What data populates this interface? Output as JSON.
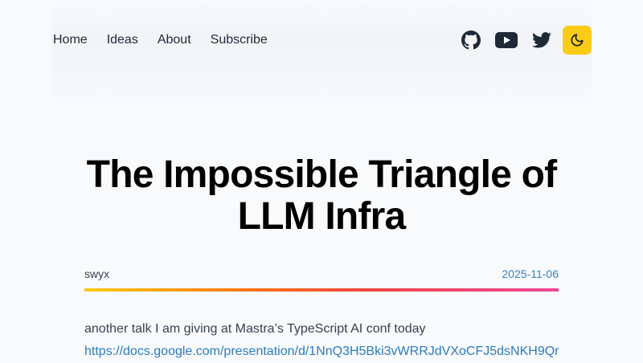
{
  "nav": {
    "items": [
      {
        "label": "Home"
      },
      {
        "label": "Ideas"
      },
      {
        "label": "About"
      },
      {
        "label": "Subscribe"
      }
    ],
    "social_icons": [
      "github-icon",
      "youtube-icon",
      "twitter-icon"
    ],
    "theme_toggle_icon": "moon-icon",
    "accent_color": "#facc15"
  },
  "post": {
    "title": "The Impossible Triangle of LLM Infra",
    "author": "swyx",
    "date": "2025-11-06",
    "intro": "another talk I am giving at Mastra’s TypeScript AI conf today",
    "link": "https://docs.google.com/presentation/d/1NnQ3H5Bki3vWRRJdVXoCFJ5dsNKH9Qr"
  }
}
